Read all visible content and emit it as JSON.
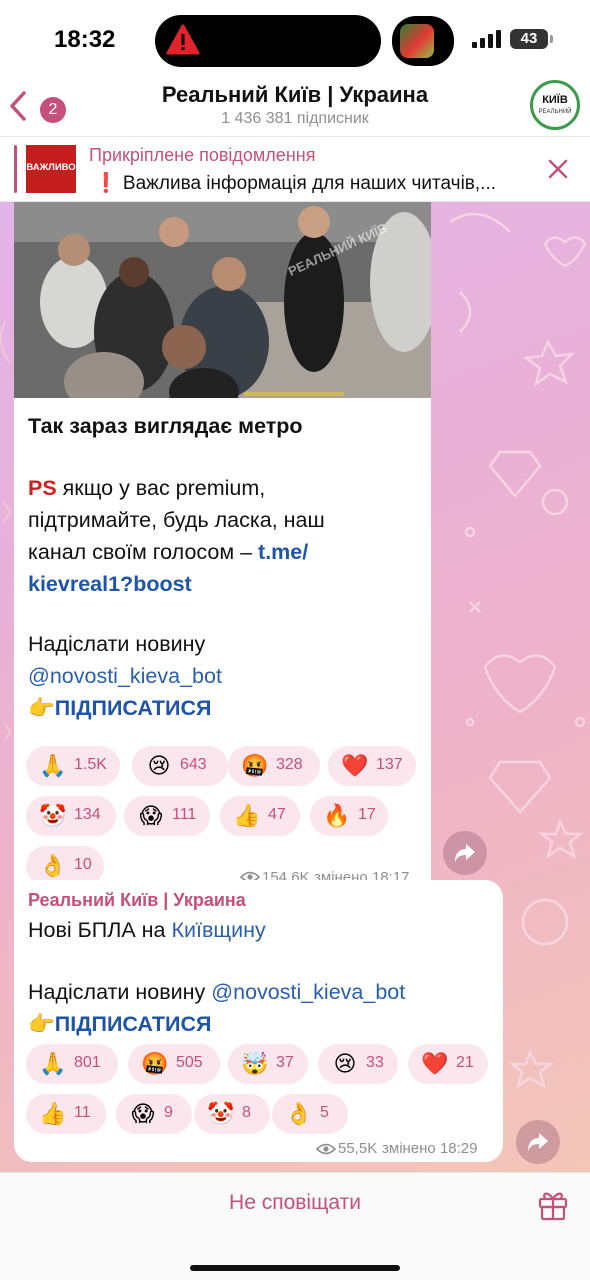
{
  "status": {
    "time": "18:32",
    "battery": "43",
    "alert_icon": "warning-icon"
  },
  "header": {
    "back_count": "2",
    "title": "Реальний Київ | Украина",
    "subscribers": "1 436 381 підписник",
    "avatar_text": "КИЇВ",
    "avatar_sub": "РЕАЛЬНИЙ"
  },
  "pinned": {
    "title": "Прикріплене повідомлення",
    "thumb_label": "ВАЖЛИВО",
    "text": "❗ Важлива інформація для наших читачів,..."
  },
  "messages": [
    {
      "heading": "Так зараз виглядає метро",
      "ps_label": "PS",
      "ps_line1": " якщо у вас premium,",
      "ps_line2": "підтримайте, будь ласка, наш",
      "ps_line3_prefix": "канал своїм голосом – ",
      "ps_link_part1": "t.me/",
      "ps_link_part2": "kievreal1?boost",
      "send_news": "Надіслати новину",
      "bot_link": "@novosti_kieva_bot",
      "subscribe": "👉ПІДПИСАТИСЯ",
      "reactions": [
        {
          "emoji": "🙏",
          "count": "1.5K"
        },
        {
          "emoji": "😢",
          "count": "643"
        },
        {
          "emoji": "🤬",
          "count": "328"
        },
        {
          "emoji": "❤️",
          "count": "137"
        },
        {
          "emoji": "🤡",
          "count": "134"
        },
        {
          "emoji": "😱",
          "count": "111"
        },
        {
          "emoji": "👍",
          "count": "47"
        },
        {
          "emoji": "🔥",
          "count": "17"
        },
        {
          "emoji": "👌",
          "count": "10"
        }
      ],
      "views": "154,6K",
      "edited": "змінено 18:17"
    },
    {
      "author": "Реальний Київ | Украина",
      "text_prefix": "Нові БПЛА на ",
      "text_link": "Київщину",
      "send_news": "Надіслати новину ",
      "bot_link": "@novosti_kieva_bot",
      "subscribe": "👉ПІДПИСАТИСЯ",
      "reactions": [
        {
          "emoji": "🙏",
          "count": "801"
        },
        {
          "emoji": "🤬",
          "count": "505"
        },
        {
          "emoji": "🤯",
          "count": "37"
        },
        {
          "emoji": "😢",
          "count": "33"
        },
        {
          "emoji": "❤️",
          "count": "21"
        },
        {
          "emoji": "👍",
          "count": "11"
        },
        {
          "emoji": "😱",
          "count": "9"
        },
        {
          "emoji": "🤡",
          "count": "8"
        },
        {
          "emoji": "👌",
          "count": "5"
        }
      ],
      "views": "55,5K",
      "edited": "змінено 18:29"
    }
  ],
  "photo_watermark": "РЕАЛЬНИЙ КИЇВ",
  "bottom": {
    "mute_label": "Не сповіщати"
  },
  "colors": {
    "accent": "#c5507c",
    "link": "#2a5fb0",
    "ps_red": "#d21e1e"
  }
}
